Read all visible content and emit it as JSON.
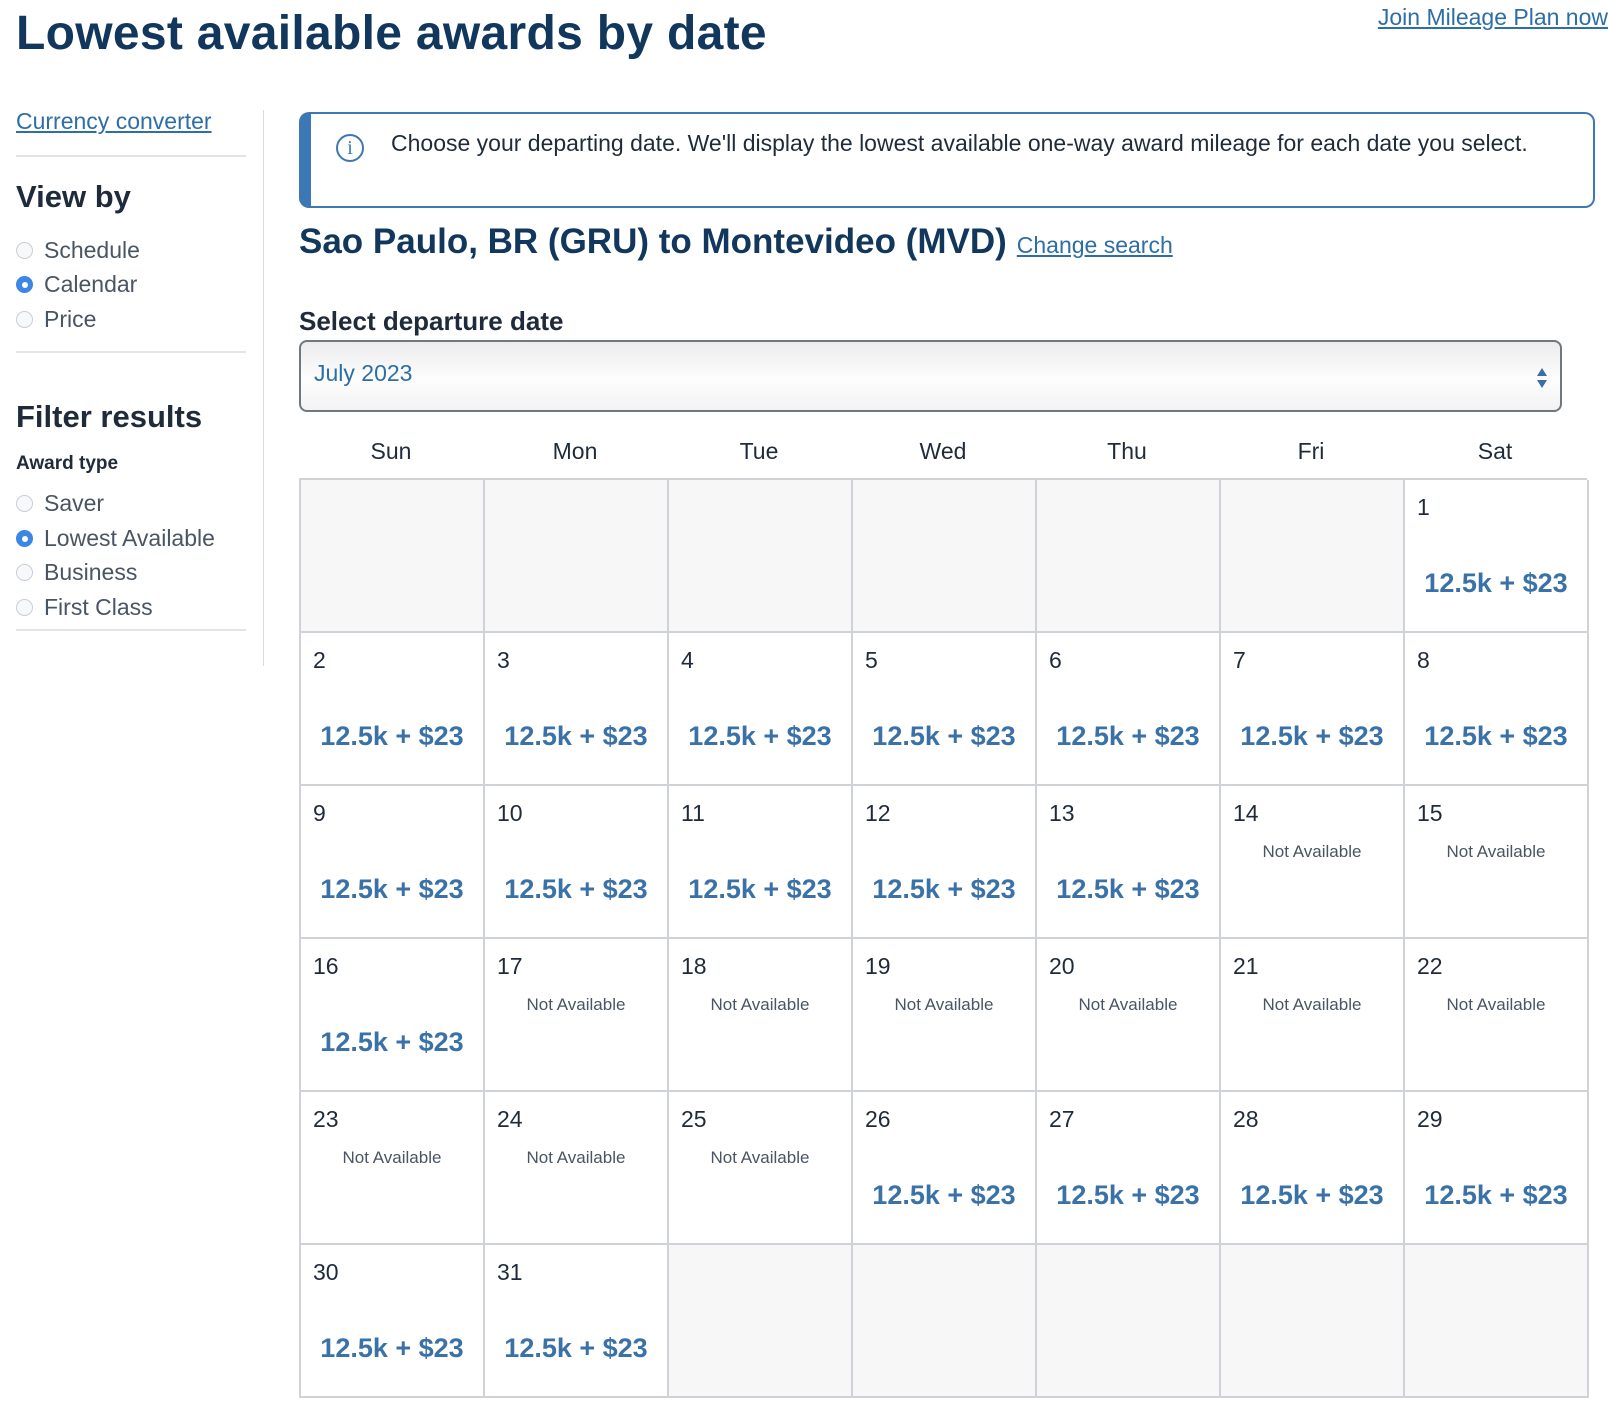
{
  "header": {
    "title": "Lowest available awards by date",
    "join_link": "Join Mileage Plan now"
  },
  "sidebar": {
    "currency_link": "Currency converter",
    "view_by": {
      "heading": "View by",
      "options": [
        {
          "label": "Schedule",
          "checked": false
        },
        {
          "label": "Calendar",
          "checked": true
        },
        {
          "label": "Price",
          "checked": false
        }
      ]
    },
    "filter": {
      "heading": "Filter results",
      "award_type_label": "Award type",
      "options": [
        {
          "label": "Saver",
          "checked": false
        },
        {
          "label": "Lowest Available",
          "checked": true
        },
        {
          "label": "Business",
          "checked": false
        },
        {
          "label": "First Class",
          "checked": false
        }
      ]
    }
  },
  "info_box": {
    "text": "Choose your departing date. We'll display the lowest available one-way award mileage for each date you select.",
    "icon": "info-icon"
  },
  "route": {
    "title": "Sao Paulo, BR (GRU) to Montevideo (MVD)",
    "change_link": "Change search"
  },
  "date_select": {
    "label": "Select departure date",
    "value": "July 2023"
  },
  "calendar": {
    "weekdays": [
      "Sun",
      "Mon",
      "Tue",
      "Wed",
      "Thu",
      "Fri",
      "Sat"
    ],
    "leading_empty": 6,
    "trailing_empty": 5,
    "not_available_label": "Not Available",
    "days": [
      {
        "day": "1",
        "price": "12.5k + $23"
      },
      {
        "day": "2",
        "price": "12.5k + $23"
      },
      {
        "day": "3",
        "price": "12.5k + $23"
      },
      {
        "day": "4",
        "price": "12.5k + $23"
      },
      {
        "day": "5",
        "price": "12.5k + $23"
      },
      {
        "day": "6",
        "price": "12.5k + $23"
      },
      {
        "day": "7",
        "price": "12.5k + $23"
      },
      {
        "day": "8",
        "price": "12.5k + $23"
      },
      {
        "day": "9",
        "price": "12.5k + $23"
      },
      {
        "day": "10",
        "price": "12.5k + $23"
      },
      {
        "day": "11",
        "price": "12.5k + $23"
      },
      {
        "day": "12",
        "price": "12.5k + $23"
      },
      {
        "day": "13",
        "price": "12.5k + $23"
      },
      {
        "day": "14",
        "price": null
      },
      {
        "day": "15",
        "price": null
      },
      {
        "day": "16",
        "price": "12.5k + $23"
      },
      {
        "day": "17",
        "price": null
      },
      {
        "day": "18",
        "price": null
      },
      {
        "day": "19",
        "price": null
      },
      {
        "day": "20",
        "price": null
      },
      {
        "day": "21",
        "price": null
      },
      {
        "day": "22",
        "price": null
      },
      {
        "day": "23",
        "price": null
      },
      {
        "day": "24",
        "price": null
      },
      {
        "day": "25",
        "price": null
      },
      {
        "day": "26",
        "price": "12.5k + $23"
      },
      {
        "day": "27",
        "price": "12.5k + $23"
      },
      {
        "day": "28",
        "price": "12.5k + $23"
      },
      {
        "day": "29",
        "price": "12.5k + $23"
      },
      {
        "day": "30",
        "price": "12.5k + $23"
      },
      {
        "day": "31",
        "price": "12.5k + $23"
      }
    ]
  },
  "colors": {
    "title": "#12375c",
    "link": "#2e6ea6",
    "price": "#3a72a8",
    "radio_checked": "#3c86e6",
    "info_border": "#3d78b6"
  }
}
